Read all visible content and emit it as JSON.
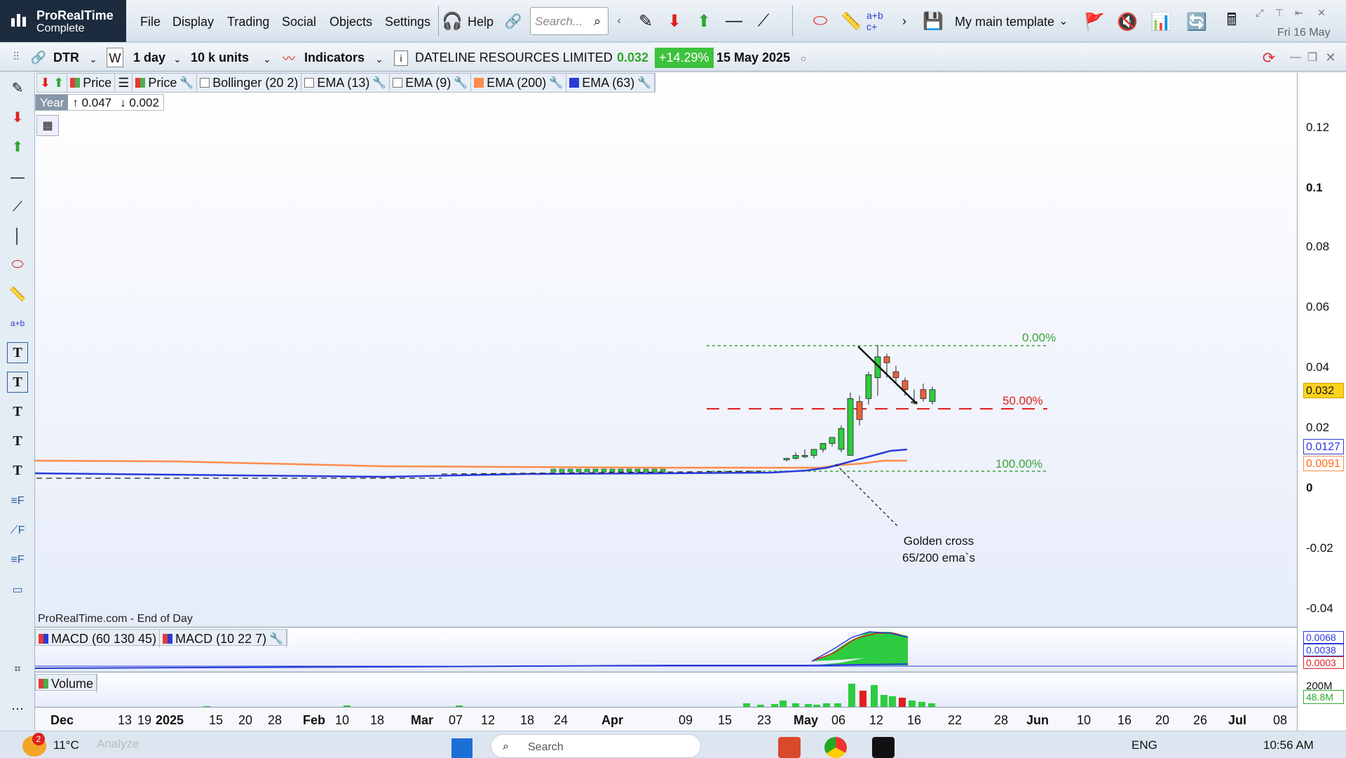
{
  "app": {
    "name": "ProRealTime",
    "edition": "Complete"
  },
  "menu": [
    "File",
    "Display",
    "Trading",
    "Social",
    "Objects",
    "Settings"
  ],
  "help_label": "Help",
  "search": {
    "placeholder": "Search..."
  },
  "template_label": "My main template",
  "date_top": "Fri 16 May",
  "toolbar2": {
    "ticker": "DTR",
    "w": "W",
    "period": "1 day",
    "units": "10 k units",
    "indicators": "Indicators",
    "company": "DATELINE RESOURCES LIMITED",
    "price": "0.032",
    "change": "+14.29%",
    "date": "15 May 2025"
  },
  "legend": [
    {
      "label": "Price",
      "color": "#4caf50",
      "check": false
    },
    {
      "label": "Price",
      "color": "#e53935",
      "check": false
    },
    {
      "label": "Bollinger (20 2)",
      "check": true
    },
    {
      "label": "EMA (13)",
      "check": true
    },
    {
      "label": "EMA (9)",
      "check": true
    },
    {
      "label": "EMA (200)",
      "color": "#ff8c4a",
      "check": false
    },
    {
      "label": "EMA (63)",
      "color": "#2a3bd8",
      "check": false
    }
  ],
  "year_box": {
    "label": "Year",
    "high": "0.047",
    "low": "0.002"
  },
  "fib": {
    "f0": "0.00%",
    "f50": "50.00%",
    "f100": "100.00%"
  },
  "annotation": {
    "line1": "Golden cross",
    "line2": "65/200 ema`s"
  },
  "source_label": "ProRealTime.com - End of Day",
  "macd_labels": [
    "MACD (60 130 45)",
    "MACD (10 22 7)"
  ],
  "volume_label": "Volume",
  "yaxis": {
    "labels": [
      "0.12",
      "0.1",
      "0.08",
      "0.06",
      "0.04",
      "0.02",
      "0",
      "-0.02",
      "-0.04"
    ],
    "price_tag": "0.032",
    "ema63_tag": "0.0127",
    "ema200_tag": "0.0091",
    "macd_tags": [
      "0.0068",
      "0.0038",
      "0.0003"
    ],
    "vol_tags": [
      "200M",
      "48.8M"
    ]
  },
  "xaxis": [
    "Dec",
    "13",
    "19",
    "2025",
    "15",
    "20",
    "28",
    "Feb",
    "10",
    "18",
    "Mar",
    "07",
    "12",
    "18",
    "24",
    "Apr",
    "09",
    "15",
    "23",
    "May",
    "06",
    "12",
    "16",
    "22",
    "28",
    "Jun",
    "10",
    "16",
    "20",
    "26",
    "Jul",
    "08"
  ],
  "taskbar": {
    "temp": "11°C",
    "notif": "2",
    "lang": "ENG",
    "time": "10:56 AM",
    "search": "Search",
    "analyze": "Analyze"
  },
  "colors": {
    "up": "#2ecc40",
    "down": "#e8623a",
    "ema200": "#ff8c4a",
    "ema63": "#2a3bd8",
    "fibGreen": "#3aa33a",
    "fibRed": "#e02020"
  }
}
